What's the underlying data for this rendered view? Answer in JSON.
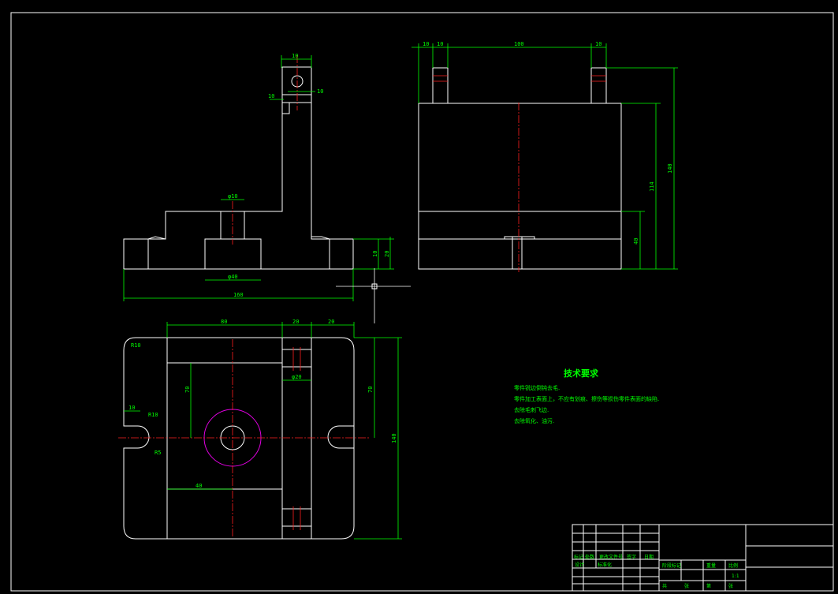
{
  "colors": {
    "background": "#000000",
    "outline": "#ffffff",
    "dimension": "#00ff00",
    "centerline": "#ff2020",
    "circle": "#e000e0"
  },
  "front_view": {
    "dims": {
      "top_width": "10",
      "lower_slot": "φ10",
      "bottom_slot": "φ40",
      "overall_width": "160",
      "side_h1": "10",
      "side_h2": "20",
      "small_a": "10",
      "small_b": "10"
    }
  },
  "side_view": {
    "dims": {
      "d1": "10",
      "d2": "10",
      "d3": "100",
      "d4": "10",
      "h_total": "140",
      "h_body": "114",
      "h_base": "40"
    }
  },
  "top_view": {
    "dims": {
      "w1": "80",
      "w2": "20",
      "w3": "20",
      "h_total": "140",
      "h1": "70",
      "h2": "70",
      "hole": "φ20",
      "center_off": "40",
      "slot_w": "10",
      "slot_r": "R10",
      "slot_r2": "R5",
      "corner_r": "R10"
    }
  },
  "requirements": {
    "title": "技术要求",
    "items": [
      "零件锐边倒钝去毛.",
      "零件加工表面上，不应有划痕、擦伤等损伤零件表面的缺陷.",
      "去除毛刺飞边.",
      "去除氧化、油污."
    ]
  },
  "title_block": {
    "labels": [
      "标记",
      "处数",
      "更改文件号",
      "签字",
      "日期",
      "设计",
      "标准化",
      "阶段标记",
      "重量",
      "比例",
      "共",
      "张",
      "第",
      "张"
    ],
    "scale": "1:1"
  }
}
